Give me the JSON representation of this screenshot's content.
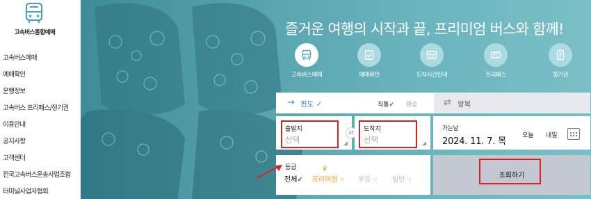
{
  "sidebar": {
    "logo_text": "고속버스통합예매",
    "items": [
      {
        "label": "고속버스예매"
      },
      {
        "label": "예매확인"
      },
      {
        "label": "운행정보"
      },
      {
        "label": "고속버스 프리패스/정기권"
      },
      {
        "label": "이용안내"
      },
      {
        "label": "공지사항"
      },
      {
        "label": "고객센터"
      },
      {
        "label": "전국고속버스운송사업조합"
      },
      {
        "label": "터미널사업자협회"
      }
    ]
  },
  "hero": {
    "headline": "즐거운 여행의 시작과 끝, 프리미엄 버스와 함께!"
  },
  "menu": [
    {
      "label": "고속버스예매",
      "icon": "bus-icon",
      "active": true
    },
    {
      "label": "예매확인",
      "icon": "check-document-icon",
      "active": false
    },
    {
      "label": "도착시간안내",
      "icon": "schedule-icon",
      "active": false
    },
    {
      "label": "프리패스",
      "icon": "ticket-icon",
      "active": false
    },
    {
      "label": "정기권",
      "icon": "pass-card-icon",
      "active": false
    }
  ],
  "booking": {
    "oneway_label": "편도 ✓",
    "direct_label": "직통✓",
    "transfer_label": "환승",
    "round_label": "왕복",
    "departure": {
      "label": "출발지",
      "value": "선택"
    },
    "arrival": {
      "label": "도착지",
      "value": "선택"
    },
    "date": {
      "label": "가는날",
      "value": "2024. 11. 7. 목",
      "today": "오늘",
      "tomorrow": "내일"
    },
    "grade": {
      "label": "등급",
      "options": [
        {
          "label": "전체✓",
          "state": "selected"
        },
        {
          "label": "프리미엄",
          "state": "available"
        },
        {
          "label": "우등",
          "state": "disabled"
        },
        {
          "label": "일반",
          "state": "disabled"
        }
      ]
    },
    "search_label": "조회하기"
  },
  "colors": {
    "hero_start": "#3f8b96",
    "hero_end": "#7bbfc6",
    "accent_blue": "#3d86d8",
    "premium_gold": "#e8a317",
    "highlight_red": "#e02020",
    "search_button": "#c3c7d1"
  }
}
